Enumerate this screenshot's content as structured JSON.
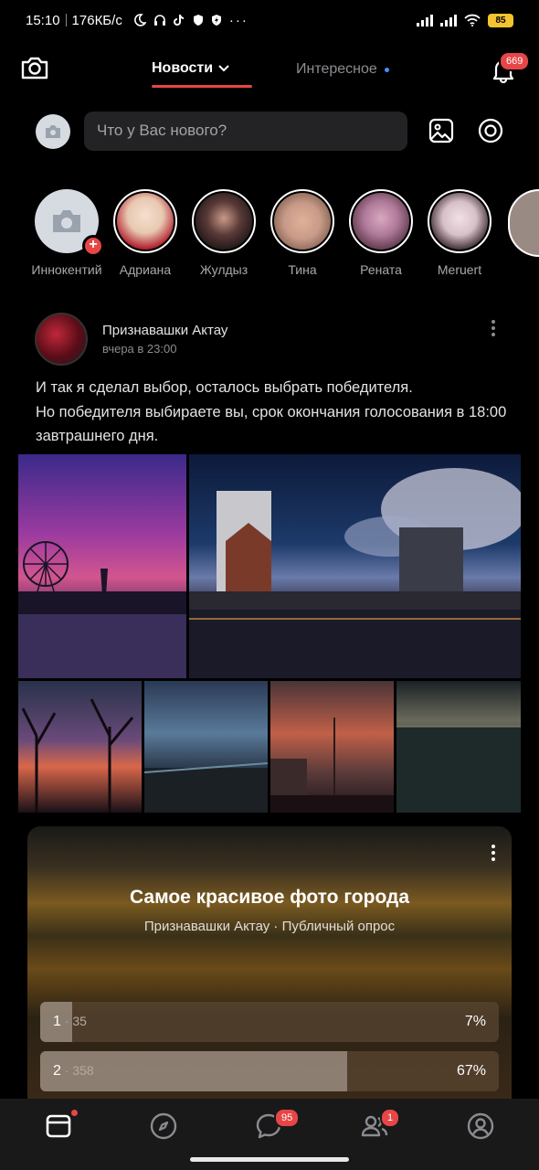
{
  "status_bar": {
    "time": "15:10",
    "net_speed": "176КБ/с",
    "battery": "85"
  },
  "header": {
    "tab_news": "Новости",
    "tab_interesting": "Интересное",
    "notifications_count": "669"
  },
  "composer": {
    "placeholder": "Что у Вас нового?"
  },
  "stories": [
    {
      "name": "Иннокентий",
      "color": "#d6dbe2"
    },
    {
      "name": "Адриана",
      "color": "#e8d8c8"
    },
    {
      "name": "Жулдыз",
      "color": "#3a2a2a"
    },
    {
      "name": "Тина",
      "color": "#c89a88"
    },
    {
      "name": "Рената",
      "color": "#b07a9a"
    },
    {
      "name": "Meruert",
      "color": "#d8c0c8"
    }
  ],
  "post": {
    "author": "Признавашки Актау",
    "time": "вчера в 23:00",
    "text_line1": "И так я сделал выбор, осталось выбрать победителя.",
    "text_line2": "Но победителя выбираете вы, срок окончания голосования в 18:00 завтрашнего дня."
  },
  "poll": {
    "title": "Самое красивое фото города",
    "subtitle": "Признавашки Актау · Публичный опрос",
    "options": [
      {
        "num": "1",
        "votes": "35",
        "percent": "7%",
        "fraction": 0.07
      },
      {
        "num": "2",
        "votes": "358",
        "percent": "67%",
        "fraction": 0.67
      }
    ]
  },
  "bottom_nav": {
    "messages_count": "95",
    "friends_count": "1"
  },
  "colors": {
    "accent": "#e64646",
    "background": "#000000",
    "tabbar": "#19191a"
  }
}
